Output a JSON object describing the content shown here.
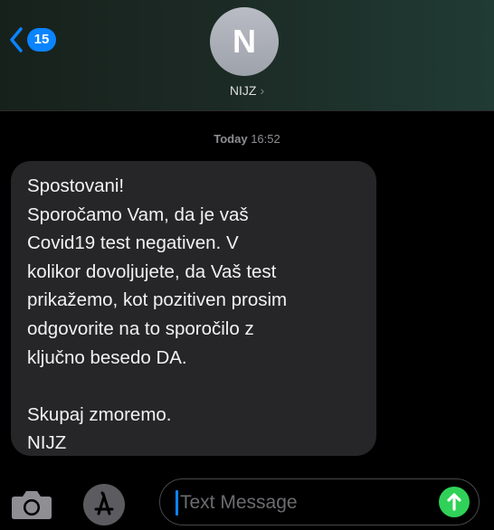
{
  "header": {
    "back_badge": "15",
    "avatar_initial": "N",
    "contact_name": "NIJZ",
    "contact_chevron": "›"
  },
  "conversation": {
    "timestamp_day": "Today",
    "timestamp_time": "16:52",
    "message": {
      "lines": [
        "Spostovani!",
        "Sporočamo Vam, da je vaš",
        "Covid19 test negativen. V",
        "kolikor dovoljujete, da Vaš test",
        "prikažemo, kot pozitiven prosim",
        "odgovorite na to sporočilo z",
        "ključno besedo DA.",
        "",
        "Skupaj zmoremo.",
        "NIJZ"
      ]
    }
  },
  "input_bar": {
    "placeholder": "Text Message",
    "icons": [
      "camera-icon",
      "app-store-icon",
      "send-arrow-icon"
    ]
  },
  "colors": {
    "accent": "#0a84ff",
    "bubble": "#262628",
    "send": "#30d158"
  }
}
